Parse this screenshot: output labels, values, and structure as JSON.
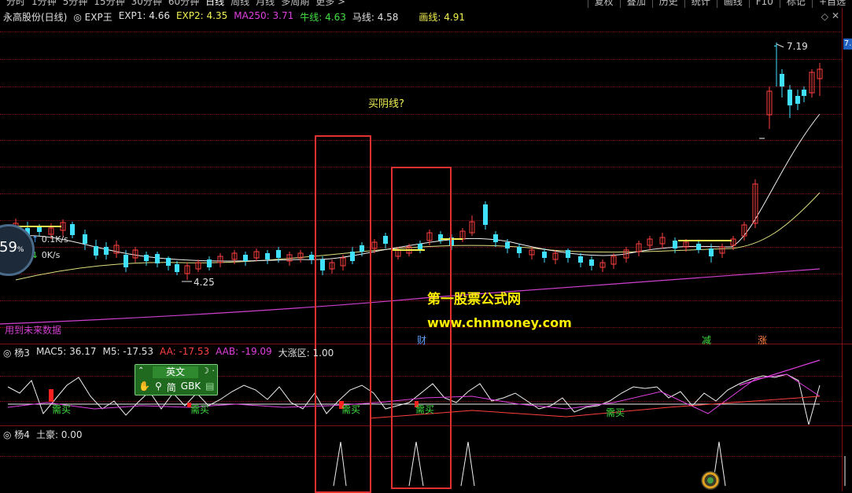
{
  "toolbar": {
    "period_tabs": [
      "分时",
      "1分钟",
      "5分钟",
      "15分钟",
      "30分钟",
      "60分钟",
      "日线",
      "周线",
      "月线",
      "多周期",
      "更多 >"
    ],
    "active_tab": "日线",
    "right_tools": [
      "复权",
      "叠加",
      "历史",
      "统计",
      "画线",
      "F10",
      "标记",
      "+自选"
    ]
  },
  "main_chart": {
    "title": "永高股份(日线)",
    "indicator_name": "EXP王",
    "legend": [
      {
        "label": "EXP1: 4.66",
        "color": "#e0e0e0"
      },
      {
        "label": "EXP2: 4.35",
        "color": "#f0f050"
      },
      {
        "label": "MA250: 3.71",
        "color": "#e040e0"
      },
      {
        "label": "牛线: 4.63",
        "color": "#40e040"
      },
      {
        "label": "马线: 4.58",
        "color": "#e0e0e0"
      },
      {
        "label": "画线: 4.91",
        "color": "#f0f050"
      }
    ],
    "high_label": "7.19",
    "low_label": "4.25",
    "price_tag": "7.",
    "annotation_question": "买阴线?",
    "future_data_note": "用到未来数据",
    "marker_cai": "财",
    "marker_jian": "减",
    "marker_zhang": "涨"
  },
  "speed_widget": {
    "percent": "59",
    "percent_suffix": "%",
    "up_rate": "0.1K/s",
    "down_rate": "0K/s"
  },
  "watermark": {
    "title": "第一股票公式网",
    "url": "www.chnmoney.com"
  },
  "sub_panel_1": {
    "name": "杨3",
    "legend": [
      {
        "label": "MAC5: 36.17",
        "color": "#e0e0e0"
      },
      {
        "label": "M5: -17.53",
        "color": "#e0e0e0"
      },
      {
        "label": "AA: -17.53",
        "color": "#ff4040"
      },
      {
        "label": "AAB: -19.09",
        "color": "#e040e0"
      },
      {
        "label": "大涨区: 1.00",
        "color": "#e0e0e0"
      }
    ],
    "buy_label": "需买"
  },
  "sub_panel_2": {
    "name": "杨4",
    "legend": [
      {
        "label": "土豪: 0.00",
        "color": "#e0e0e0"
      }
    ]
  },
  "ime": {
    "mode": "英文",
    "row2": [
      "简",
      "GBK"
    ]
  }
}
